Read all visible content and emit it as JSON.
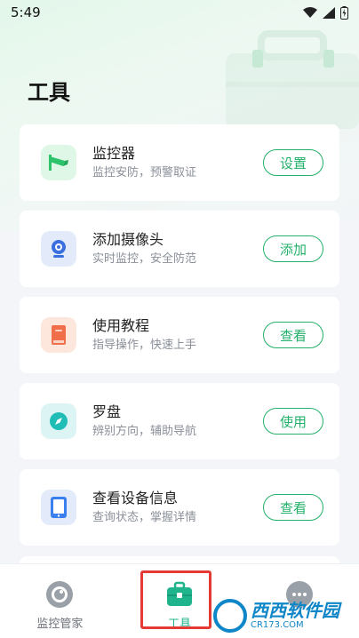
{
  "status_bar": {
    "time": "5:49"
  },
  "page": {
    "title": "工具"
  },
  "cards": [
    {
      "title": "监控器",
      "subtitle": "监控安防，预警取证",
      "button": "设置",
      "icon": "camera-icon",
      "icon_bg": "#dff7e7",
      "icon_color": "#2cc36b"
    },
    {
      "title": "添加摄像头",
      "subtitle": "实时监控，安全防范",
      "button": "添加",
      "icon": "webcam-icon",
      "icon_bg": "#e3ebfb",
      "icon_color": "#3a6fe0"
    },
    {
      "title": "使用教程",
      "subtitle": "指导操作，快速上手",
      "button": "查看",
      "icon": "book-icon",
      "icon_bg": "#fde6dc",
      "icon_color": "#f06e4a"
    },
    {
      "title": "罗盘",
      "subtitle": "辨别方向，辅助导航",
      "button": "使用",
      "icon": "compass-icon",
      "icon_bg": "#dcf5f4",
      "icon_color": "#1fbdb5"
    },
    {
      "title": "查看设备信息",
      "subtitle": "查询状态，掌握详情",
      "button": "查看",
      "icon": "tablet-icon",
      "icon_bg": "#e3ebfb",
      "icon_color": "#3a7ff0"
    }
  ],
  "nav": {
    "items": [
      {
        "label": "监控管家",
        "icon": "monitor-icon"
      },
      {
        "label": "工具",
        "icon": "toolbox-icon",
        "active": true
      },
      {
        "label": "",
        "icon": "more-icon"
      }
    ]
  },
  "watermark": {
    "main": "西西软件园",
    "sub": "CR173.COM"
  },
  "colors": {
    "accent": "#23b06a",
    "highlight": "#e53935"
  }
}
